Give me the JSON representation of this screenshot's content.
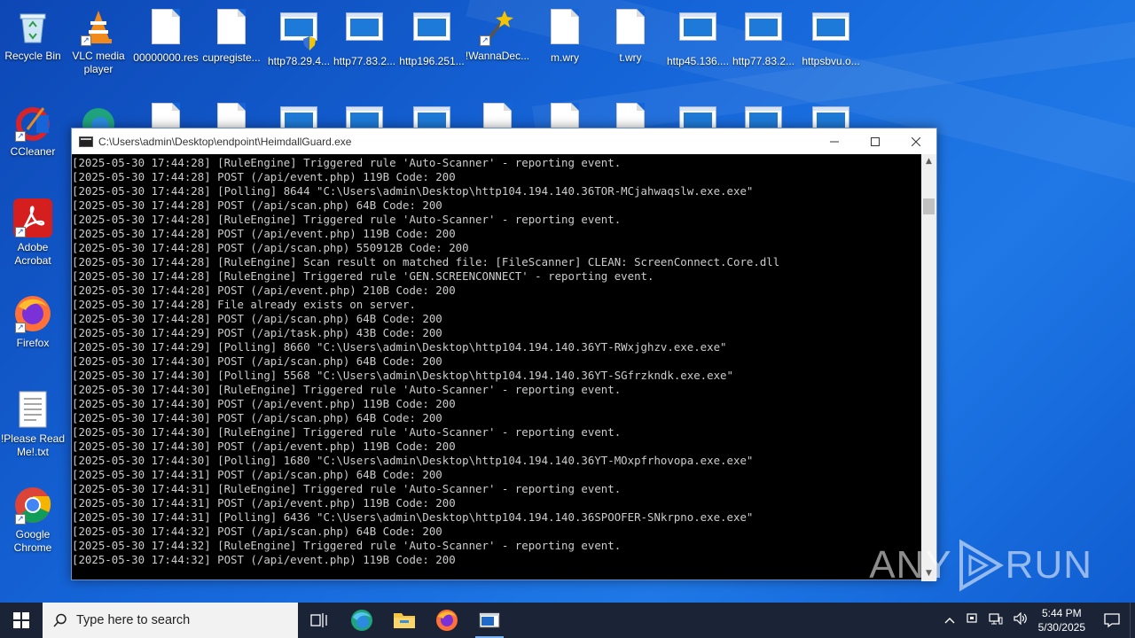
{
  "desktop": {
    "icons": [
      {
        "label": "Recycle Bin"
      },
      {
        "label": "VLC media player"
      },
      {
        "label": "00000000.res"
      },
      {
        "label": "cupregiste..."
      },
      {
        "label": "http78.29.4..."
      },
      {
        "label": "http77.83.2..."
      },
      {
        "label": "http196.251..."
      },
      {
        "label": "!WannaDec..."
      },
      {
        "label": "m.wry"
      },
      {
        "label": "t.wry"
      },
      {
        "label": "http45.136...."
      },
      {
        "label": "http77.83.2..."
      },
      {
        "label": "httpsbvu.o..."
      },
      {
        "label": "CCleaner"
      },
      {
        "label": "Adobe Acrobat"
      },
      {
        "label": "Firefox"
      },
      {
        "label": "!Please Read Me!.txt"
      },
      {
        "label": "Google Chrome"
      }
    ]
  },
  "window": {
    "title": "C:\\Users\\admin\\Desktop\\endpoint\\HeimdallGuard.exe",
    "lines": [
      "[2025-05-30 17:44:28] [RuleEngine] Triggered rule 'Auto-Scanner' - reporting event.",
      "[2025-05-30 17:44:28] POST (/api/event.php) 119B Code: 200",
      "[2025-05-30 17:44:28] [Polling] 8644 \"C:\\Users\\admin\\Desktop\\http104.194.140.36TOR-MCjahwaqslw.exe.exe\"",
      "[2025-05-30 17:44:28] POST (/api/scan.php) 64B Code: 200",
      "[2025-05-30 17:44:28] [RuleEngine] Triggered rule 'Auto-Scanner' - reporting event.",
      "[2025-05-30 17:44:28] POST (/api/event.php) 119B Code: 200",
      "[2025-05-30 17:44:28] POST (/api/scan.php) 550912B Code: 200",
      "[2025-05-30 17:44:28] [RuleEngine] Scan result on matched file: [FileScanner] CLEAN: ScreenConnect.Core.dll",
      "[2025-05-30 17:44:28] [RuleEngine] Triggered rule 'GEN.SCREENCONNECT' - reporting event.",
      "[2025-05-30 17:44:28] POST (/api/event.php) 210B Code: 200",
      "[2025-05-30 17:44:28] File already exists on server.",
      "[2025-05-30 17:44:28] POST (/api/scan.php) 64B Code: 200",
      "[2025-05-30 17:44:29] POST (/api/task.php) 43B Code: 200",
      "[2025-05-30 17:44:29] [Polling] 8660 \"C:\\Users\\admin\\Desktop\\http104.194.140.36YT-RWxjghzv.exe.exe\"",
      "[2025-05-30 17:44:30] POST (/api/scan.php) 64B Code: 200",
      "[2025-05-30 17:44:30] [Polling] 5568 \"C:\\Users\\admin\\Desktop\\http104.194.140.36YT-SGfrzkndk.exe.exe\"",
      "[2025-05-30 17:44:30] [RuleEngine] Triggered rule 'Auto-Scanner' - reporting event.",
      "[2025-05-30 17:44:30] POST (/api/event.php) 119B Code: 200",
      "[2025-05-30 17:44:30] POST (/api/scan.php) 64B Code: 200",
      "[2025-05-30 17:44:30] [RuleEngine] Triggered rule 'Auto-Scanner' - reporting event.",
      "[2025-05-30 17:44:30] POST (/api/event.php) 119B Code: 200",
      "[2025-05-30 17:44:30] [Polling] 1680 \"C:\\Users\\admin\\Desktop\\http104.194.140.36YT-MOxpfrhovopa.exe.exe\"",
      "[2025-05-30 17:44:31] POST (/api/scan.php) 64B Code: 200",
      "[2025-05-30 17:44:31] [RuleEngine] Triggered rule 'Auto-Scanner' - reporting event.",
      "[2025-05-30 17:44:31] POST (/api/event.php) 119B Code: 200",
      "[2025-05-30 17:44:31] [Polling] 6436 \"C:\\Users\\admin\\Desktop\\http104.194.140.36SPOOFER-SNkrpno.exe.exe\"",
      "[2025-05-30 17:44:32] POST (/api/scan.php) 64B Code: 200",
      "[2025-05-30 17:44:32] [RuleEngine] Triggered rule 'Auto-Scanner' - reporting event.",
      "[2025-05-30 17:44:32] POST (/api/event.php) 119B Code: 200"
    ]
  },
  "watermark": {
    "left": "ANY",
    "right": "RUN"
  },
  "taskbar": {
    "search_placeholder": "Type here to search",
    "time": "5:44 PM",
    "date": "5/30/2025"
  }
}
